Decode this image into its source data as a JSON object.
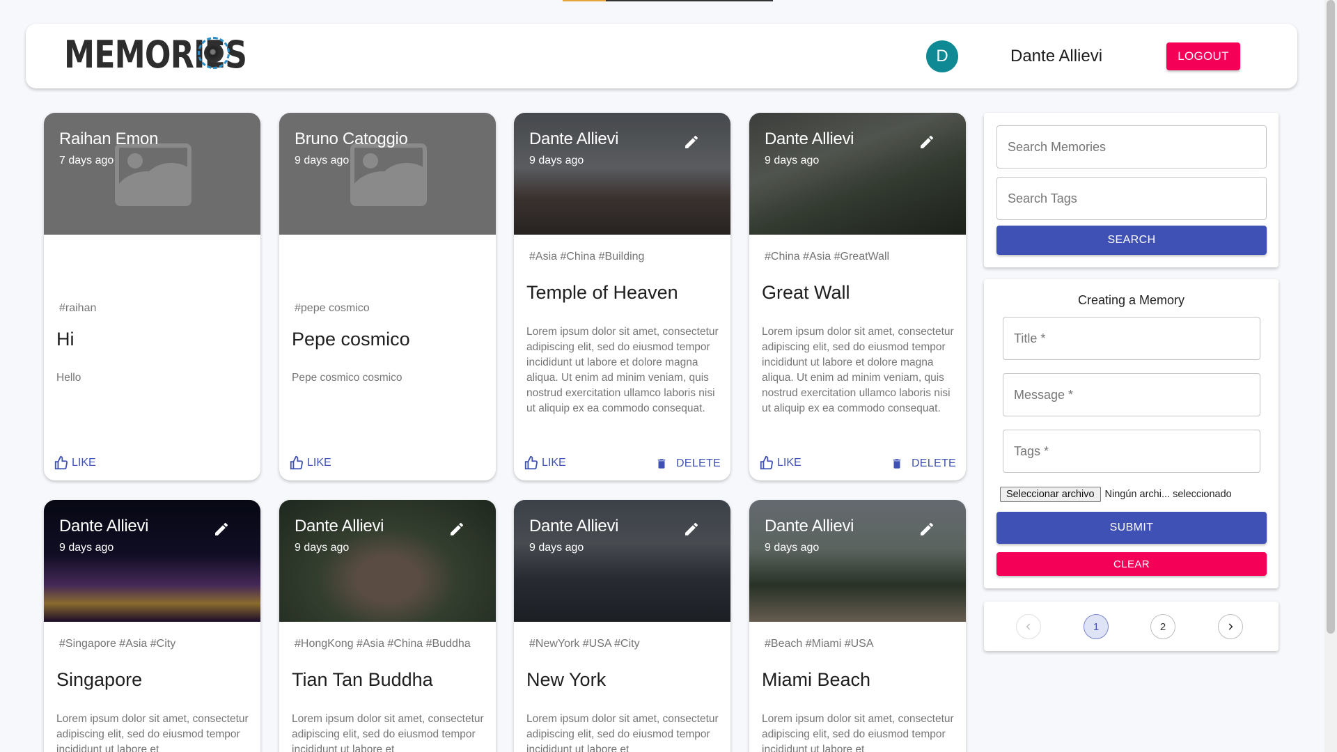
{
  "header": {
    "brand_text": "MEMORIES",
    "avatar_initial": "D",
    "user_name": "Dante Allievi",
    "logout_label": "LOGOUT",
    "colors": {
      "avatar": "#0f8a94",
      "logout": "#f50057"
    }
  },
  "posts": [
    {
      "author": "Raihan Emon",
      "date": "7 days ago",
      "tags": "#raihan",
      "title": "Hi",
      "message": "Hello",
      "image": "placeholder",
      "like_label": "LIKE",
      "editable": false
    },
    {
      "author": "Bruno Catoggio",
      "date": "9 days ago",
      "tags": "#pepe cosmico",
      "title": "Pepe cosmico",
      "message": "Pepe cosmico cosmico",
      "image": "placeholder",
      "like_label": "LIKE",
      "editable": false
    },
    {
      "author": "Dante Allievi",
      "date": "9 days ago",
      "tags": "#Asia #China #Building",
      "title": "Temple of Heaven",
      "message": "Lorem ipsum dolor sit amet, consectetur adipiscing elit, sed do eiusmod tempor incididunt ut labore et dolore magna aliqua. Ut enim ad minim veniam, quis nostrud exercitation ullamco laboris nisi ut aliquip ex ea commodo consequat.",
      "image": "temple",
      "like_label": "LIKE",
      "delete_label": "DELETE",
      "editable": true
    },
    {
      "author": "Dante Allievi",
      "date": "9 days ago",
      "tags": "#China #Asia #GreatWall",
      "title": "Great Wall",
      "message": "Lorem ipsum dolor sit amet, consectetur adipiscing elit, sed do eiusmod tempor incididunt ut labore et dolore magna aliqua. Ut enim ad minim veniam, quis nostrud exercitation ullamco laboris nisi ut aliquip ex ea commodo consequat.",
      "image": "wall",
      "like_label": "LIKE",
      "delete_label": "DELETE",
      "editable": true
    },
    {
      "author": "Dante Allievi",
      "date": "9 days ago",
      "tags": "#Singapore #Asia #City",
      "title": "Singapore",
      "message": "Lorem ipsum dolor sit amet, consectetur adipiscing elit, sed do eiusmod tempor incididunt ut labore et",
      "image": "singapore",
      "editable": true
    },
    {
      "author": "Dante Allievi",
      "date": "9 days ago",
      "tags": "#HongKong #Asia #China #Buddha",
      "title": "Tian Tan Buddha",
      "message": "Lorem ipsum dolor sit amet, consectetur adipiscing elit, sed do eiusmod tempor incididunt ut labore et",
      "image": "buddha",
      "editable": true
    },
    {
      "author": "Dante Allievi",
      "date": "9 days ago",
      "tags": "#NewYork #USA #City",
      "title": "New York",
      "message": "Lorem ipsum dolor sit amet, consectetur adipiscing elit, sed do eiusmod tempor incididunt ut labore et",
      "image": "newyork",
      "editable": true
    },
    {
      "author": "Dante Allievi",
      "date": "9 days ago",
      "tags": "#Beach #Miami #USA",
      "title": "Miami Beach",
      "message": "Lorem ipsum dolor sit amet, consectetur adipiscing elit, sed do eiusmod tempor incididunt ut labore et",
      "image": "miami",
      "editable": true
    }
  ],
  "search": {
    "memories_placeholder": "Search Memories",
    "tags_placeholder": "Search Tags",
    "button_label": "SEARCH"
  },
  "form": {
    "title": "Creating a Memory",
    "title_placeholder": "Title *",
    "message_placeholder": "Message *",
    "tags_placeholder": "Tags *",
    "file_button_label": "Seleccionar archivo",
    "file_status": "Ningún archi... seleccionado",
    "submit_label": "SUBMIT",
    "clear_label": "CLEAR"
  },
  "pagination": {
    "pages": [
      "1",
      "2"
    ],
    "current": "1",
    "prev_icon": "chevron-left-icon",
    "next_icon": "chevron-right-icon"
  },
  "icons": {
    "like": "thumb-up-icon",
    "delete": "trash-icon",
    "edit": "pencil-icon"
  },
  "colors": {
    "primary": "#3f51b5",
    "secondary": "#f50057"
  }
}
